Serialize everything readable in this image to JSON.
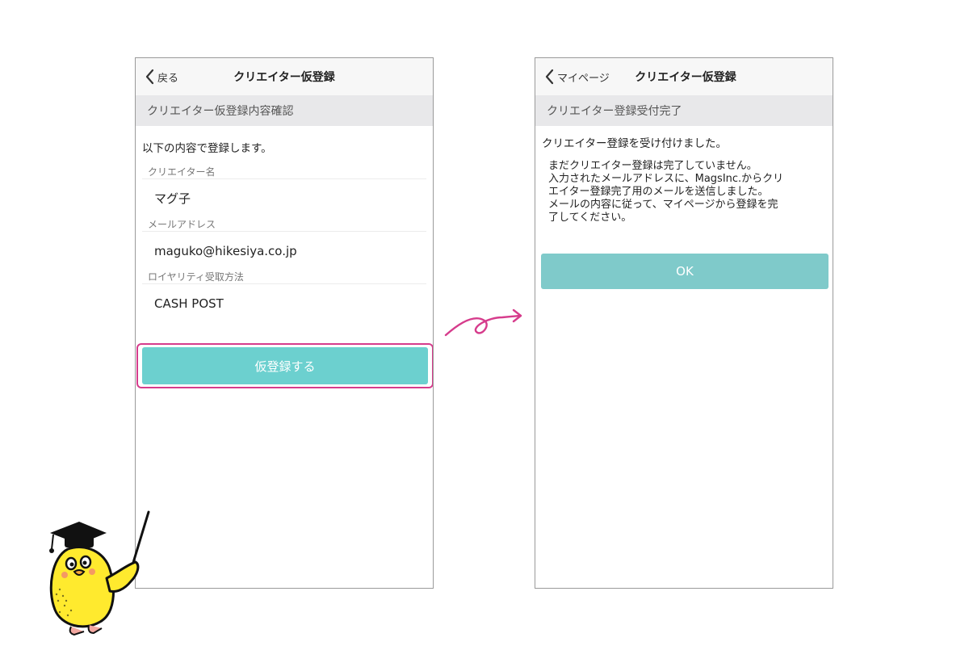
{
  "left_screen": {
    "nav": {
      "back_label": "戻る",
      "title": "クリエイター仮登録"
    },
    "section_header": "クリエイター仮登録内容確認",
    "intro": "以下の内容で登録します。",
    "fields": [
      {
        "label": "クリエイター名",
        "value": "マグ子"
      },
      {
        "label": "メールアドレス",
        "value": "maguko@hikesiya.co.jp"
      },
      {
        "label": "ロイヤリティ受取方法",
        "value": "CASH POST"
      }
    ],
    "submit_label": "仮登録する"
  },
  "right_screen": {
    "nav": {
      "back_label": "マイページ",
      "title": "クリエイター仮登録"
    },
    "section_header": "クリエイター登録受付完了",
    "message": "クリエイター登録を受け付けました。",
    "detail_lines": [
      "まだクリエイター登録は完了していません。",
      "入力されたメールアドレスに、MagsInc.からクリ",
      "エイター登録完了用のメールを送信しました。",
      "メールの内容に従って、マイページから登録を完",
      "了してください。"
    ],
    "ok_label": "OK"
  },
  "colors": {
    "accent": "#6cd0cf",
    "ok_button": "#7fcaca",
    "highlight": "#d63c8c",
    "mascot_yellow": "#ffea2e"
  },
  "icons": [
    "chevron-left-icon",
    "curly-arrow-icon",
    "graduation-chick-mascot"
  ]
}
